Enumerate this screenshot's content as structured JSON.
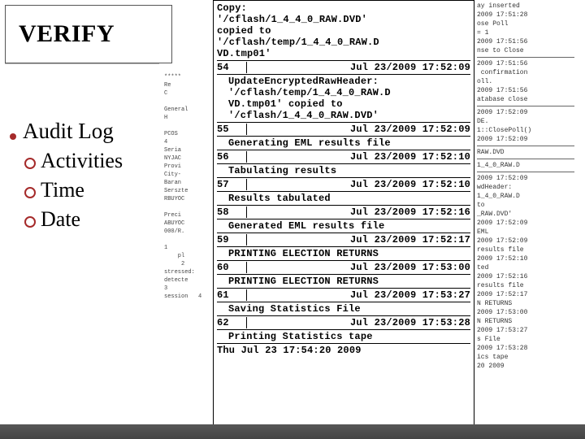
{
  "header": {
    "title": "VERIFY"
  },
  "left": {
    "bullet": "Audit Log",
    "subs": [
      "Activities",
      "Time",
      "Date"
    ]
  },
  "bgcol_text": "*****\nRe\nC\n\nGeneral\nH\n\nPCOS\n4\nSeria\nNYJAC\nProvi\nCity-\nBaran\nSerszte\nRBUYOC\n\nPreci\nABUYOC\n000/R.\n\n1\n    pl\n     2\nstressed:\ndetecte\n3\nsession   4",
  "printout": {
    "top_block": "Copy:\n'/cflash/1_4_4_0_RAW.DVD'\ncopied to\n'/cflash/temp/1_4_4_0_RAW.D\nVD.tmp01'",
    "entries": [
      {
        "idx": "54",
        "ts": "Jul 23/2009 17:52:09",
        "msg": "UpdateEncryptedRawHeader:\n'/cflash/temp/1_4_4_0_RAW.D\nVD.tmp01' copied to\n'/cflash/1_4_4_0_RAW.DVD'"
      },
      {
        "idx": "55",
        "ts": "Jul 23/2009 17:52:09",
        "msg": "Generating EML results file"
      },
      {
        "idx": "56",
        "ts": "Jul 23/2009 17:52:10",
        "msg": "Tabulating results"
      },
      {
        "idx": "57",
        "ts": "Jul 23/2009 17:52:10",
        "msg": "Results tabulated"
      },
      {
        "idx": "58",
        "ts": "Jul 23/2009 17:52:16",
        "msg": "Generated EML results file"
      },
      {
        "idx": "59",
        "ts": "Jul 23/2009 17:52:17",
        "msg": "PRINTING ELECTION RETURNS"
      },
      {
        "idx": "60",
        "ts": "Jul 23/2009 17:53:00",
        "msg": "PRINTING ELECTION RETURNS"
      },
      {
        "idx": "61",
        "ts": "Jul 23/2009 17:53:27",
        "msg": "Saving Statistics File"
      },
      {
        "idx": "62",
        "ts": "Jul 23/2009 17:53:28",
        "msg": "Printing Statistics tape"
      }
    ],
    "footer": "Thu Jul 23 17:54:20 2009"
  },
  "rightstrip": [
    "ay inserted",
    "2009 17:51:28",
    "ose Poll",
    "= 1",
    "2009 17:51:56",
    "nse to Close",
    "",
    "2009 17:51:56",
    " confirmation",
    "oll.",
    "2009 17:51:56",
    "atabase close",
    "",
    "2009 17:52:09",
    "DE.",
    "1::ClosePoll()",
    "2009 17:52:09",
    "",
    "RAW.DVD",
    "",
    "1_4_0_RAW.D",
    "",
    "2009 17:52:09",
    "wdHeader:",
    "1_4_0_RAW.D",
    "to",
    "_RAW.DVD'",
    "2009 17:52:09",
    "EML",
    "2009 17:52:09",
    "results file",
    "2009 17:52:10",
    "ted",
    "2009 17:52:16",
    "results file",
    "2009 17:52:17",
    "N RETURNS",
    "2009 17:53:00",
    "N RETURNS",
    "2009 17:53:27",
    "s File",
    "2009 17:53:28",
    "ics tape",
    "20 2009"
  ]
}
